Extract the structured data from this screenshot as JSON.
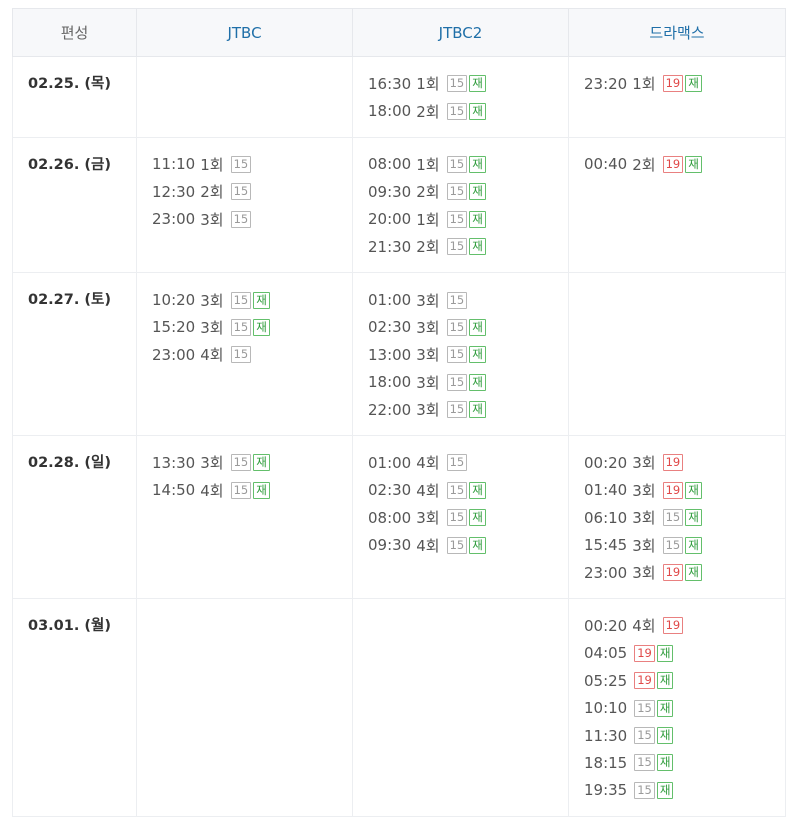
{
  "header": {
    "label": "편성",
    "channels": [
      "JTBC",
      "JTBC2",
      "드라맥스"
    ]
  },
  "rows": [
    {
      "date": "02.25. (목)",
      "channels": [
        [],
        [
          {
            "time": "16:30",
            "ep": "1회",
            "rating": "15",
            "rerun": true
          },
          {
            "time": "18:00",
            "ep": "2회",
            "rating": "15",
            "rerun": true
          }
        ],
        [
          {
            "time": "23:20",
            "ep": "1회",
            "rating": "19",
            "rerun": true
          }
        ]
      ]
    },
    {
      "date": "02.26. (금)",
      "channels": [
        [
          {
            "time": "11:10",
            "ep": "1회",
            "rating": "15",
            "rerun": false
          },
          {
            "time": "12:30",
            "ep": "2회",
            "rating": "15",
            "rerun": false
          },
          {
            "time": "23:00",
            "ep": "3회",
            "rating": "15",
            "rerun": false
          }
        ],
        [
          {
            "time": "08:00",
            "ep": "1회",
            "rating": "15",
            "rerun": true
          },
          {
            "time": "09:30",
            "ep": "2회",
            "rating": "15",
            "rerun": true
          },
          {
            "time": "20:00",
            "ep": "1회",
            "rating": "15",
            "rerun": true
          },
          {
            "time": "21:30",
            "ep": "2회",
            "rating": "15",
            "rerun": true
          }
        ],
        [
          {
            "time": "00:40",
            "ep": "2회",
            "rating": "19",
            "rerun": true
          }
        ]
      ]
    },
    {
      "date": "02.27. (토)",
      "channels": [
        [
          {
            "time": "10:20",
            "ep": "3회",
            "rating": "15",
            "rerun": true
          },
          {
            "time": "15:20",
            "ep": "3회",
            "rating": "15",
            "rerun": true
          },
          {
            "time": "23:00",
            "ep": "4회",
            "rating": "15",
            "rerun": false
          }
        ],
        [
          {
            "time": "01:00",
            "ep": "3회",
            "rating": "15",
            "rerun": false
          },
          {
            "time": "02:30",
            "ep": "3회",
            "rating": "15",
            "rerun": true
          },
          {
            "time": "13:00",
            "ep": "3회",
            "rating": "15",
            "rerun": true
          },
          {
            "time": "18:00",
            "ep": "3회",
            "rating": "15",
            "rerun": true
          },
          {
            "time": "22:00",
            "ep": "3회",
            "rating": "15",
            "rerun": true
          }
        ],
        []
      ]
    },
    {
      "date": "02.28. (일)",
      "channels": [
        [
          {
            "time": "13:30",
            "ep": "3회",
            "rating": "15",
            "rerun": true
          },
          {
            "time": "14:50",
            "ep": "4회",
            "rating": "15",
            "rerun": true
          }
        ],
        [
          {
            "time": "01:00",
            "ep": "4회",
            "rating": "15",
            "rerun": false
          },
          {
            "time": "02:30",
            "ep": "4회",
            "rating": "15",
            "rerun": true
          },
          {
            "time": "08:00",
            "ep": "3회",
            "rating": "15",
            "rerun": true
          },
          {
            "time": "09:30",
            "ep": "4회",
            "rating": "15",
            "rerun": true
          }
        ],
        [
          {
            "time": "00:20",
            "ep": "3회",
            "rating": "19",
            "rerun": false
          },
          {
            "time": "01:40",
            "ep": "3회",
            "rating": "19",
            "rerun": true
          },
          {
            "time": "06:10",
            "ep": "3회",
            "rating": "15",
            "rerun": true
          },
          {
            "time": "15:45",
            "ep": "3회",
            "rating": "15",
            "rerun": true
          },
          {
            "time": "23:00",
            "ep": "3회",
            "rating": "19",
            "rerun": true
          }
        ]
      ]
    },
    {
      "date": "03.01. (월)",
      "channels": [
        [],
        [],
        [
          {
            "time": "00:20",
            "ep": "4회",
            "rating": "19",
            "rerun": false
          },
          {
            "time": "04:05",
            "ep": "",
            "rating": "19",
            "rerun": true
          },
          {
            "time": "05:25",
            "ep": "",
            "rating": "19",
            "rerun": true
          },
          {
            "time": "10:10",
            "ep": "",
            "rating": "15",
            "rerun": true
          },
          {
            "time": "11:30",
            "ep": "",
            "rating": "15",
            "rerun": true
          },
          {
            "time": "18:15",
            "ep": "",
            "rating": "15",
            "rerun": true
          },
          {
            "time": "19:35",
            "ep": "",
            "rating": "15",
            "rerun": true
          }
        ]
      ]
    }
  ],
  "rerun_label": "재",
  "colors": {
    "channel_header": "#1f6fa8",
    "rating_15": "#9a9a9a",
    "rating_19": "#e04848",
    "rerun": "#2d9b3a"
  }
}
